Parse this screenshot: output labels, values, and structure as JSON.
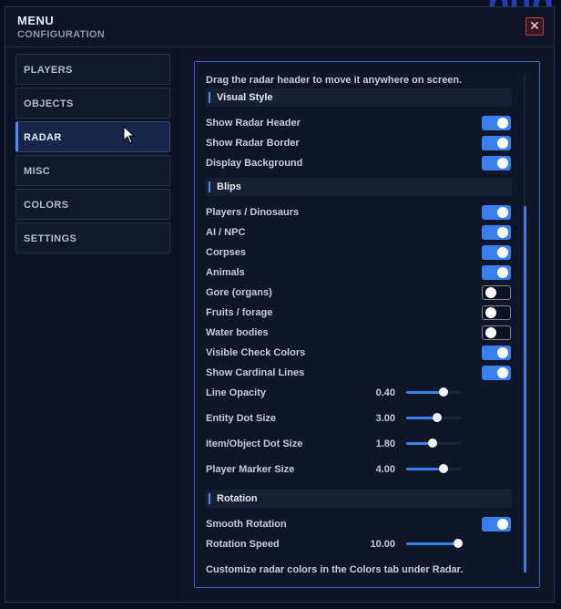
{
  "window": {
    "title": "MENU",
    "subtitle": "CONFIGURATION",
    "close_label": "✕"
  },
  "nav": [
    {
      "label": "PLAYERS",
      "active": false
    },
    {
      "label": "OBJECTS",
      "active": false
    },
    {
      "label": "RADAR",
      "active": true
    },
    {
      "label": "MISC",
      "active": false
    },
    {
      "label": "COLORS",
      "active": false
    },
    {
      "label": "SETTINGS",
      "active": false
    }
  ],
  "radar": {
    "hint_top": "Drag the radar header to move it anywhere on screen.",
    "sections": {
      "visual_style": "Visual Style",
      "blips": "Blips",
      "rotation": "Rotation"
    },
    "visual": [
      {
        "label": "Show Radar Header",
        "on": true
      },
      {
        "label": "Show Radar Border",
        "on": true
      },
      {
        "label": "Display Background",
        "on": true
      }
    ],
    "blips": [
      {
        "label": "Players / Dinosaurs",
        "on": true
      },
      {
        "label": "AI / NPC",
        "on": true
      },
      {
        "label": "Corpses",
        "on": true
      },
      {
        "label": "Animals",
        "on": true
      },
      {
        "label": "Gore (organs)",
        "on": false
      },
      {
        "label": "Fruits / forage",
        "on": false
      },
      {
        "label": "Water bodies",
        "on": false
      },
      {
        "label": "Visible Check Colors",
        "on": true
      },
      {
        "label": "Show Cardinal Lines",
        "on": true
      }
    ],
    "sliders": [
      {
        "label": "Line Opacity",
        "value": "0.40",
        "level": 0.68
      },
      {
        "label": "Entity Dot Size",
        "value": "3.00",
        "level": 0.57
      },
      {
        "label": "Item/Object Dot Size",
        "value": "1.80",
        "level": 0.48
      },
      {
        "label": "Player Marker Size",
        "value": "4.00",
        "level": 0.68
      }
    ],
    "smooth_rotation": {
      "label": "Smooth Rotation",
      "on": true
    },
    "rotation_speed": {
      "label": "Rotation Speed",
      "value": "10.00",
      "level": 0.95
    },
    "hint_bottom": "Customize radar colors in the Colors tab under Radar."
  }
}
